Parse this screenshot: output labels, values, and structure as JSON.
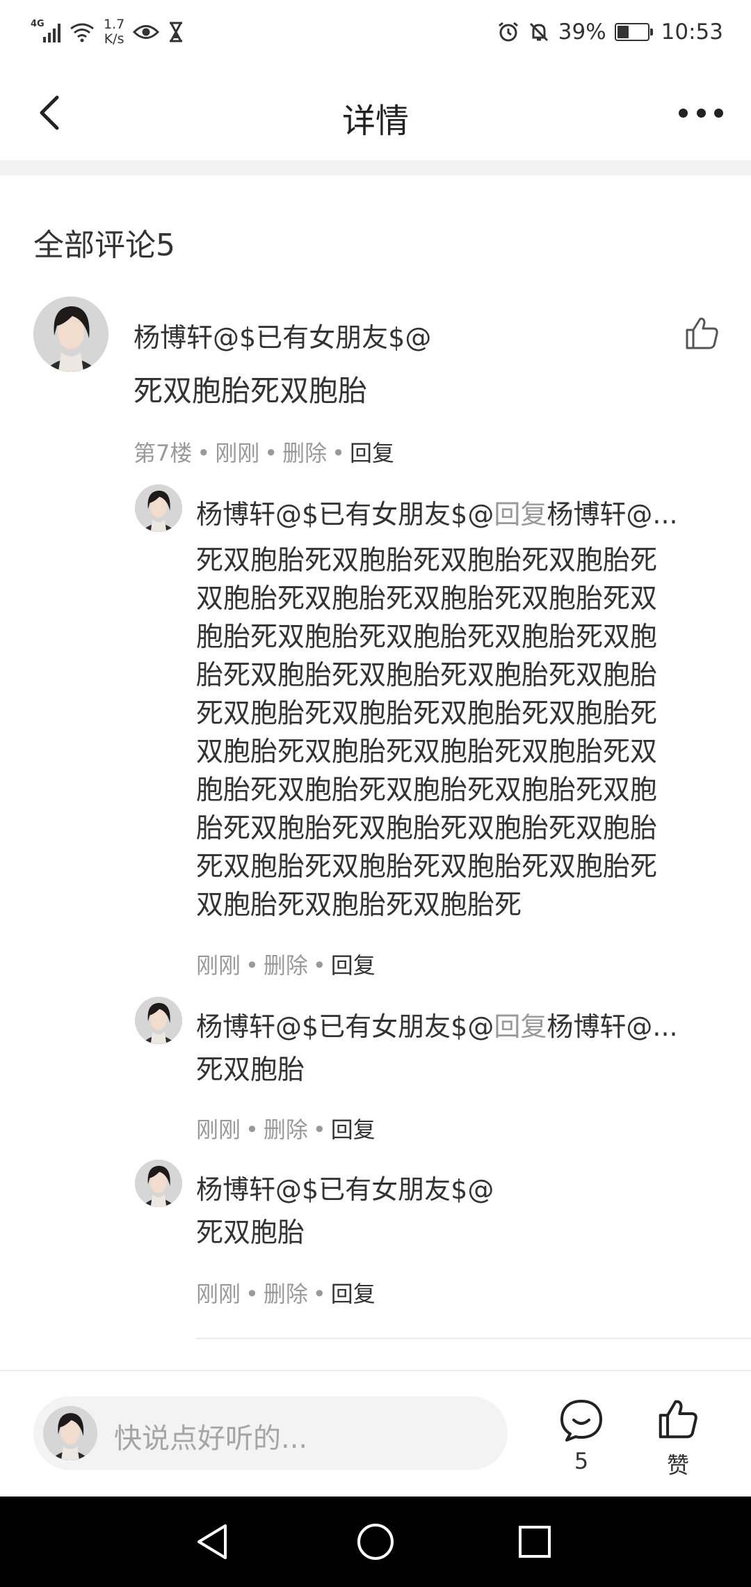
{
  "status_bar": {
    "network": "4G",
    "speed_value": "1.7",
    "speed_unit": "K/s",
    "battery": "39%",
    "battery_level": 0.39,
    "time": "10:53",
    "icons": [
      "signal-icon",
      "wifi-icon",
      "eye-icon",
      "hourglass-icon",
      "alarm-icon",
      "mute-icon",
      "battery-icon"
    ]
  },
  "header": {
    "title": "详情",
    "back_icon": "back-arrow-icon",
    "more_icon": "more-dots-icon"
  },
  "comments_header": "全部评论5",
  "main_comment": {
    "author": "杨博轩@$已有女朋友$@",
    "content": "死双胞胎死双胞胎",
    "floor": "第7楼",
    "time": "刚刚",
    "delete": "删除",
    "reply": "回复"
  },
  "replies": [
    {
      "author": "杨博轩@$已有女朋友$@",
      "reply_word": "回复",
      "target": "杨博轩@...",
      "content_lines": [
        "死双胞胎死双胞胎死双胞胎死双胞胎死",
        "双胞胎死双胞胎死双胞胎死双胞胎死双",
        "胞胎死双胞胎死双胞胎死双胞胎死双胞",
        "胎死双胞胎死双胞胎死双胞胎死双胞胎",
        "死双胞胎死双胞胎死双胞胎死双胞胎死",
        "双胞胎死双胞胎死双胞胎死双胞胎死双",
        "胞胎死双胞胎死双胞胎死双胞胎死双胞",
        "胎死双胞胎死双胞胎死双胞胎死双胞胎",
        "死双胞胎死双胞胎死双胞胎死双胞胎死",
        "双胞胎死双胞胎死双胞胎死"
      ],
      "time": "刚刚",
      "delete": "删除",
      "reply": "回复"
    },
    {
      "author": "杨博轩@$已有女朋友$@",
      "reply_word": "回复",
      "target": "杨博轩@...",
      "content": "死双胞胎",
      "time": "刚刚",
      "delete": "删除",
      "reply": "回复"
    },
    {
      "author": "杨博轩@$已有女朋友$@",
      "content": "死双胞胎",
      "time": "刚刚",
      "delete": "删除",
      "reply": "回复"
    }
  ],
  "bottom_bar": {
    "input_placeholder": "快说点好听的...",
    "comment_count": "5",
    "like_label": "赞"
  },
  "nav_bar": {
    "icons": [
      "nav-back-icon",
      "nav-home-icon",
      "nav-recents-icon"
    ]
  },
  "meta_separator": "•",
  "colors": {
    "text": "#333333",
    "muted": "#999999",
    "band": "#f2f2f2",
    "input_bg": "#f3f3f3",
    "nav_bg": "#000000"
  }
}
